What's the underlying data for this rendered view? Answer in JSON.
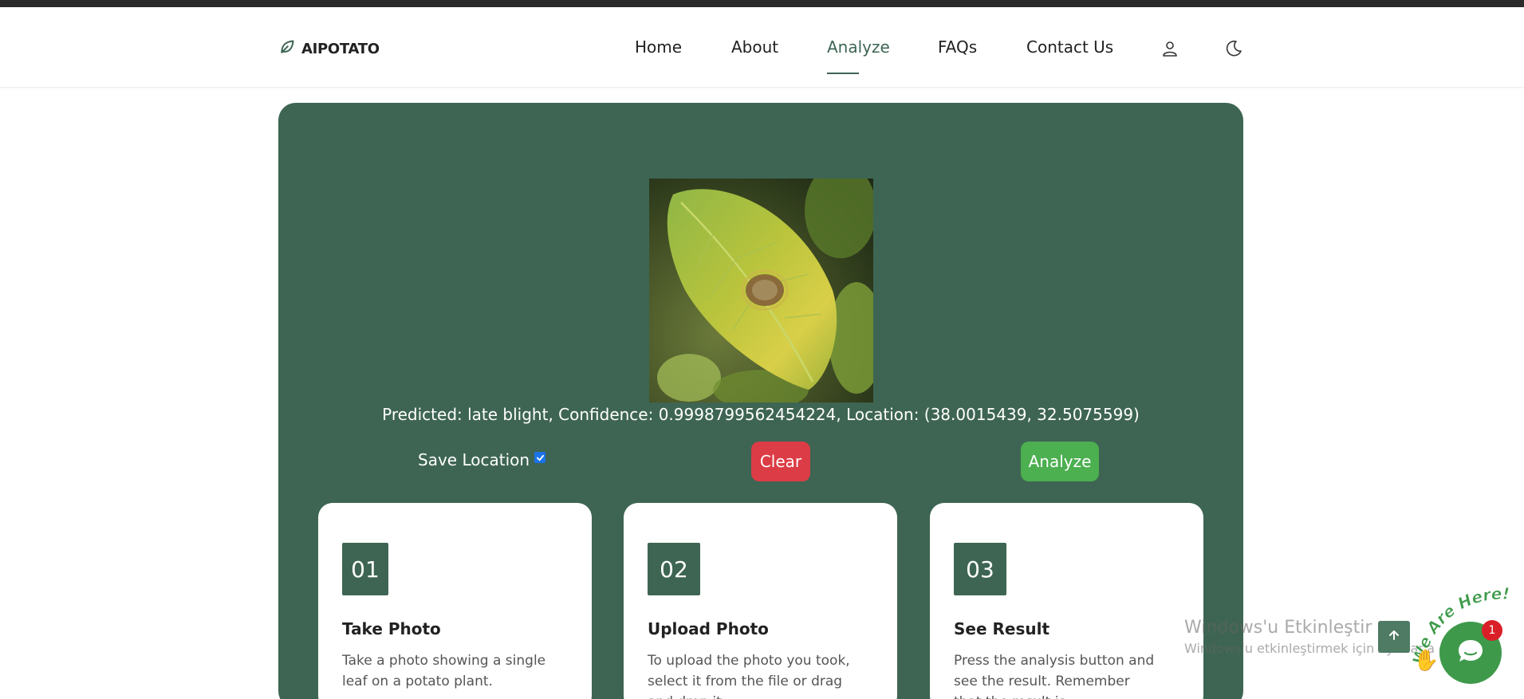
{
  "brand": {
    "name": "AIPOTATO",
    "icon": "leaf-icon",
    "color": "#3e6553"
  },
  "nav": {
    "links": [
      {
        "label": "Home",
        "active": false
      },
      {
        "label": "About",
        "active": false
      },
      {
        "label": "Analyze",
        "active": true
      },
      {
        "label": "FAQs",
        "active": false
      },
      {
        "label": "Contact Us",
        "active": false
      }
    ],
    "icons": [
      "user-icon",
      "moon-icon"
    ]
  },
  "analyze": {
    "image_icon": "potato-leaf-photo",
    "prediction": "Predicted: late blight, Confidence: 0.9998799562454224, Location: (38.0015439, 32.5075599)",
    "save_location_label": "Save Location",
    "save_location_checked": true,
    "clear_label": "Clear",
    "analyze_label": "Analyze",
    "colors": {
      "panel": "#3e6553",
      "clear": "#dc3c45",
      "analyze": "#4caf50"
    }
  },
  "steps": [
    {
      "number": "01",
      "title": "Take Photo",
      "description": "Take a photo showing a single leaf on a potato plant."
    },
    {
      "number": "02",
      "title": "Upload Photo",
      "description": "To upload the photo you took, select it from the file or drag and drop it."
    },
    {
      "number": "03",
      "title": "See Result",
      "description": "Press the analysis button and see the result. Remember that the result is"
    }
  ],
  "windows_watermark": {
    "line1": "Windows'u Etkinleştir",
    "line2": "Windows'u etkinleştirmek için Ayarlar'a gidin."
  },
  "chat": {
    "label": "We Are Here!",
    "badge_count": "1",
    "icon": "chat-bubble-icon"
  },
  "scroll_top": {
    "icon": "arrow-up-icon"
  }
}
